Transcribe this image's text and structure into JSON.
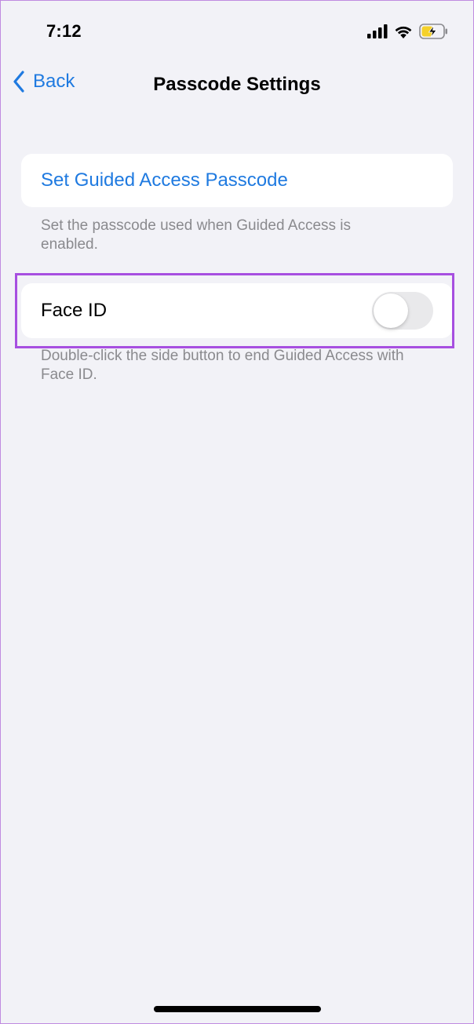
{
  "status_bar": {
    "time": "7:12",
    "icons": [
      "cellular-signal-icon",
      "wifi-icon",
      "battery-charging-icon"
    ]
  },
  "nav": {
    "back_label": "Back",
    "title": "Passcode Settings"
  },
  "passcode_section": {
    "action_label": "Set Guided Access Passcode",
    "footnote": "Set the passcode used when Guided Access is enabled."
  },
  "faceid_section": {
    "label": "Face ID",
    "toggle_on": false,
    "footnote": "Double-click the side button to end Guided Access with Face ID."
  },
  "colors": {
    "accent": "#1f7ae0",
    "background": "#f2f2f7",
    "highlight": "#a74fe0",
    "battery": "#f5d12a"
  }
}
